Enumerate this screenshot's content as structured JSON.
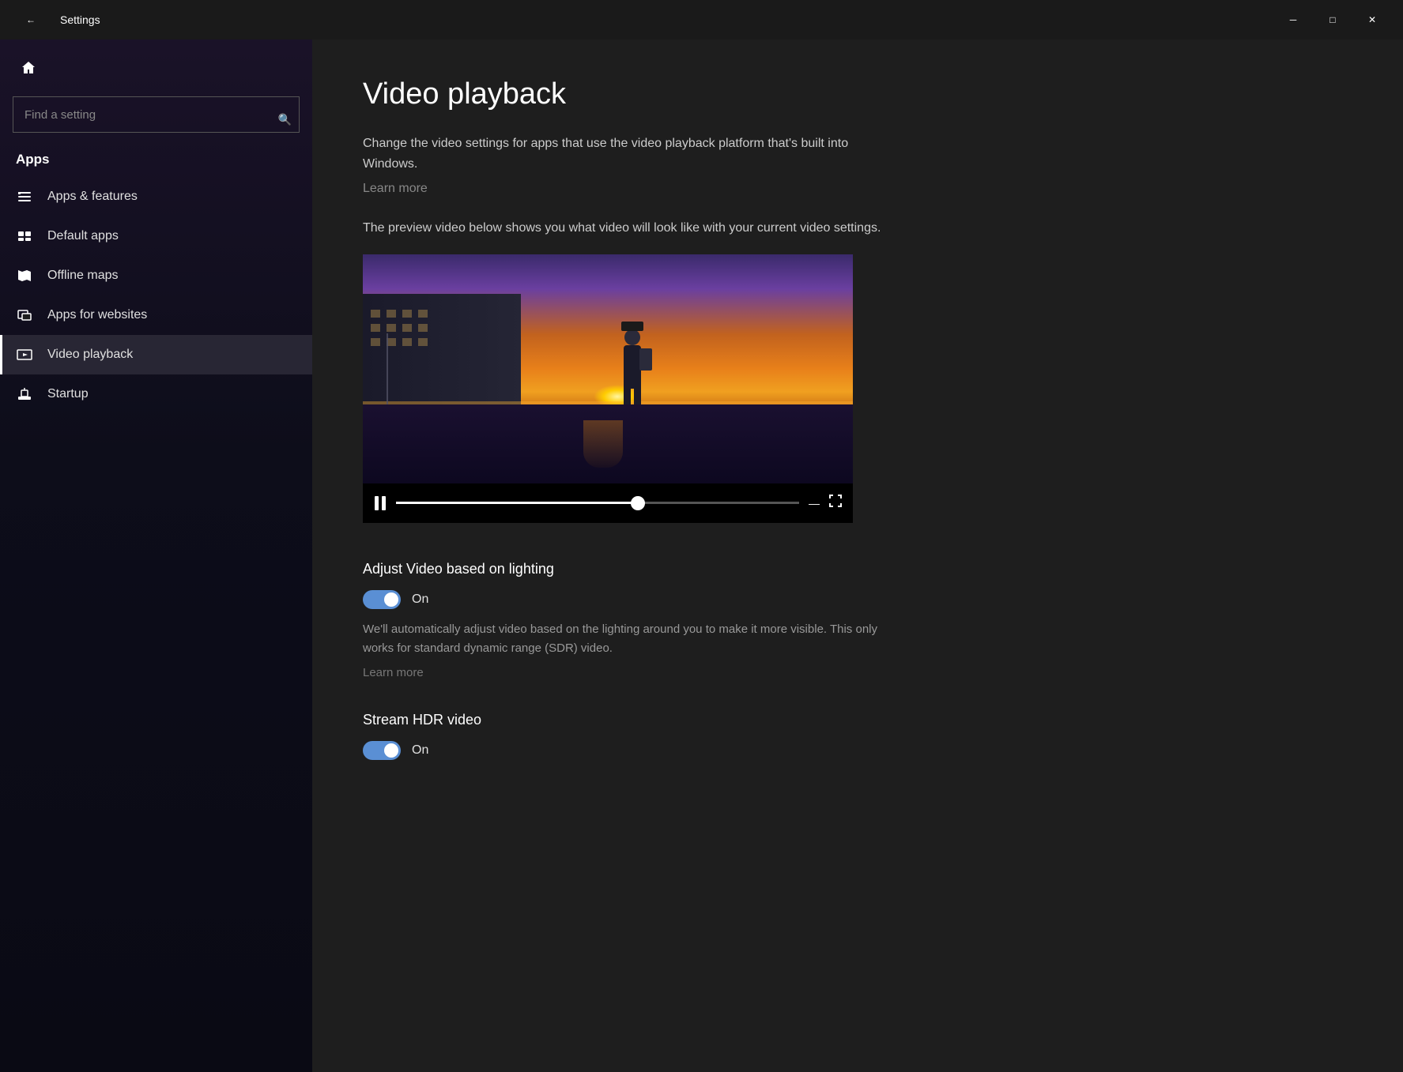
{
  "titlebar": {
    "back_icon": "←",
    "title": "Settings",
    "min_icon": "─",
    "max_icon": "□",
    "close_icon": "✕"
  },
  "sidebar": {
    "home_icon": "⌂",
    "search_placeholder": "Find a setting",
    "search_icon": "🔍",
    "section_title": "Apps",
    "items": [
      {
        "id": "apps-features",
        "label": "Apps & features",
        "icon": "☰"
      },
      {
        "id": "default-apps",
        "label": "Default apps",
        "icon": "≡"
      },
      {
        "id": "offline-maps",
        "label": "Offline maps",
        "icon": "◫"
      },
      {
        "id": "apps-websites",
        "label": "Apps for websites",
        "icon": "◫"
      },
      {
        "id": "video-playback",
        "label": "Video playback",
        "icon": "▭"
      },
      {
        "id": "startup",
        "label": "Startup",
        "icon": "▭"
      }
    ]
  },
  "content": {
    "page_title": "Video playback",
    "description": "Change the video settings for apps that use the video playback platform that's built into Windows.",
    "learn_more": "Learn more",
    "preview_text": "The preview video below shows you what video will look like with your current video settings.",
    "adjust_video_title": "Adjust Video based on lighting",
    "adjust_video_toggle": "On",
    "adjust_video_description": "We'll automatically adjust video based on the lighting around you to make it more visible. This only works for standard dynamic range (SDR) video.",
    "adjust_video_learn_more": "Learn more",
    "stream_hdr_title": "Stream HDR video",
    "stream_hdr_toggle": "On"
  }
}
